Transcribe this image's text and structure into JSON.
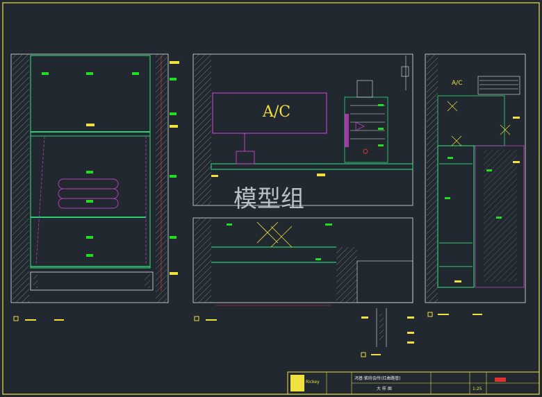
{
  "drawing": {
    "ac_label_main": "A/C",
    "ac_label_small": "A/C",
    "watermark": "模型组",
    "colors": {
      "background": "#212830",
      "frame": "#f0e040",
      "wall": "#e8e8e8",
      "green": "#2ecc71",
      "magenta": "#c040c0",
      "red": "#e03030",
      "tag": "#22dd22"
    }
  },
  "title_block": {
    "logo": "Rickey",
    "project": "鸿基·紫府会所(红曲路管)",
    "sheet_name": "大 样 图",
    "scale": "1:25"
  }
}
